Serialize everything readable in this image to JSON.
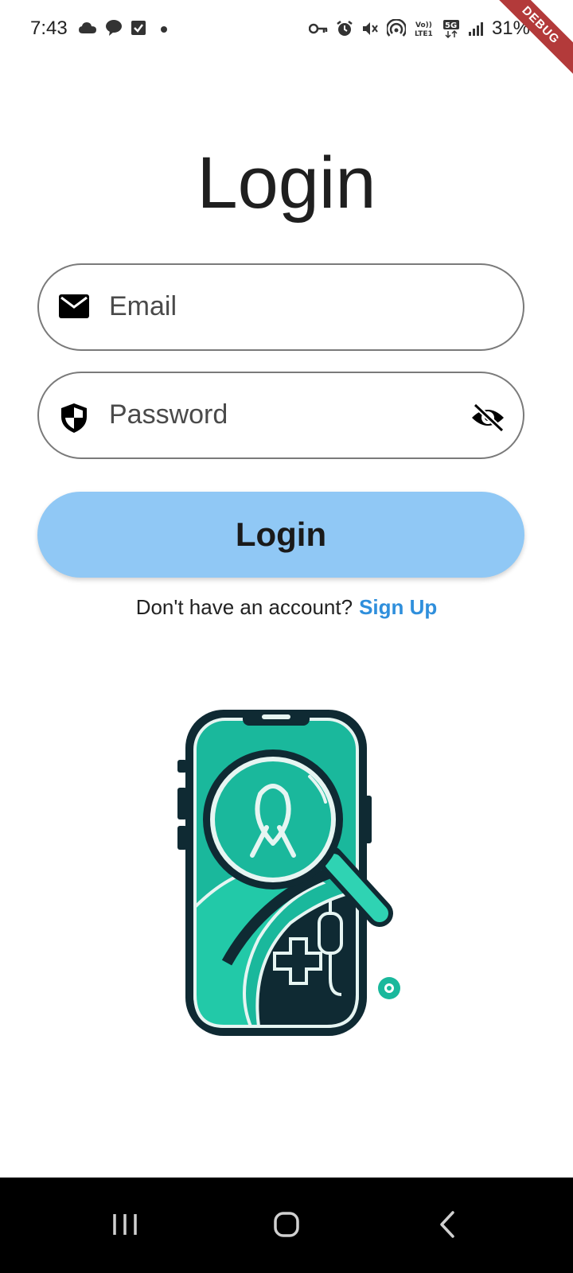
{
  "status_bar": {
    "time": "7:43",
    "battery": "31%",
    "left_icons": [
      "cloud-icon",
      "chat-bubble-icon",
      "checkbox-icon",
      "dot-icon"
    ],
    "right_icons": [
      "key-icon",
      "alarm-icon",
      "mute-icon",
      "hotspot-icon",
      "volte-icon",
      "5g-icon",
      "signal-icon",
      "battery-icon"
    ]
  },
  "debug_banner": "DEBUG",
  "page": {
    "title": "Login"
  },
  "form": {
    "email_placeholder": "Email",
    "password_placeholder": "Password",
    "login_button": "Login",
    "signup_prompt": "Don't have an account?",
    "signup_link": "Sign Up"
  },
  "colors": {
    "button_bg": "#90c8f5",
    "link": "#2f8fdc",
    "logo_teal": "#1ab89c",
    "logo_dark": "#0f2a33"
  }
}
